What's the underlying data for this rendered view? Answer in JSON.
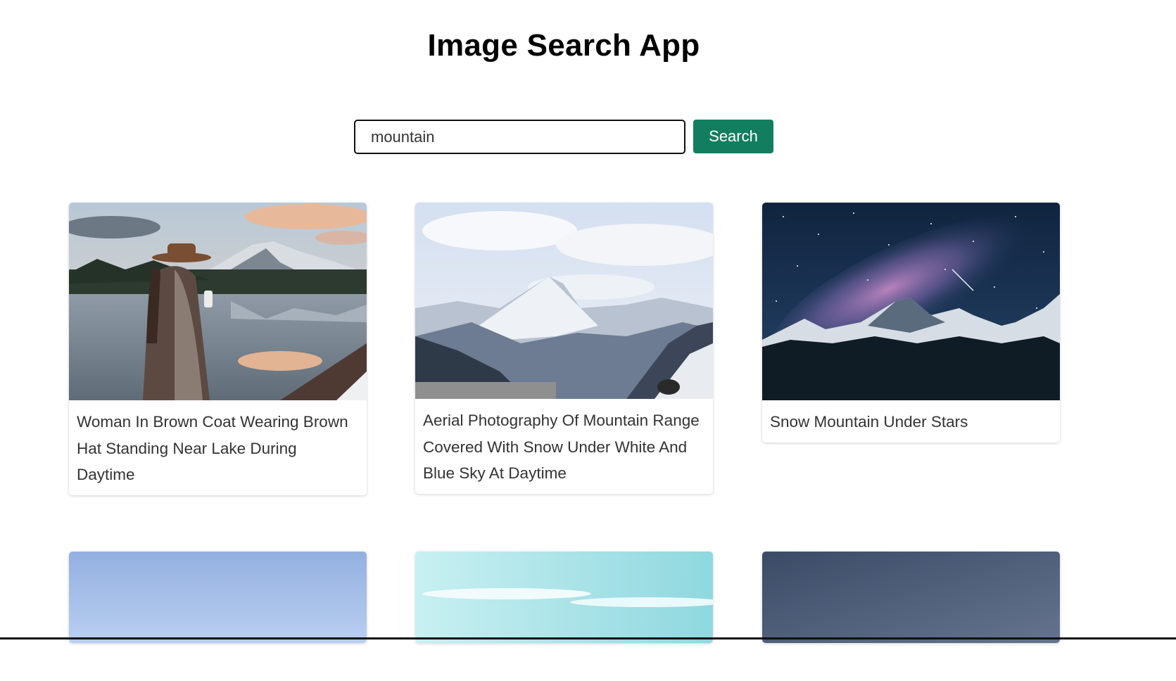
{
  "app": {
    "title": "Image Search App"
  },
  "search": {
    "value": "mountain",
    "button_label": "Search"
  },
  "results": [
    {
      "caption": "Woman In Brown Coat Wearing Brown Hat Standing Near Lake During Daytime"
    },
    {
      "caption": "Aerial Photography Of Mountain Range Covered With Snow Under White And Blue Sky At Daytime"
    },
    {
      "caption": "Snow Mountain Under Stars"
    }
  ],
  "colors": {
    "button": "#137e5f"
  }
}
